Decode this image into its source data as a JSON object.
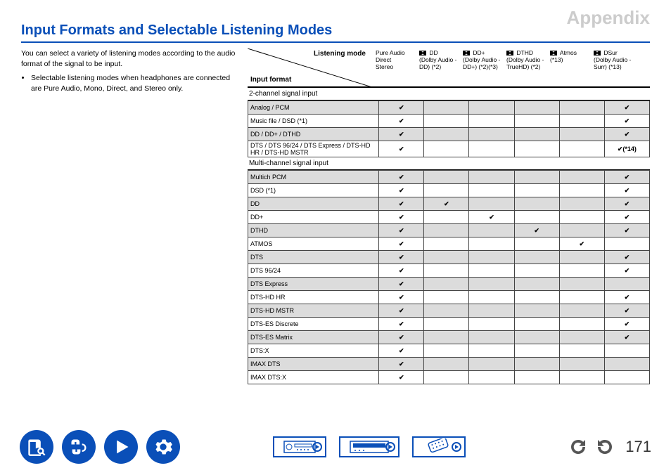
{
  "appendix": "Appendix",
  "title": "Input Formats and Selectable Listening Modes",
  "intro": "You can select a variety of listening modes according to the audio format of the signal to be input.",
  "bullet": "Selectable listening modes when headphones are connected are Pure Audio, Mono, Direct, and Stereo only.",
  "labels": {
    "listening_mode": "Listening mode",
    "input_format": "Input format"
  },
  "cols": [
    "Pure Audio\nDirect\nStereo",
    "DD (Dolby Audio - DD) (*2)",
    "DD+ (Dolby Audio - DD+) (*2)(*3)",
    "DTHD (Dolby Audio - TrueHD) (*2)",
    "Atmos (*13)",
    "DSur (Dolby Audio - Surr) (*13)"
  ],
  "col_has_dolby": [
    false,
    true,
    true,
    true,
    true,
    true
  ],
  "sections": [
    {
      "title": "2-channel signal input",
      "rows": [
        {
          "name": "Analog / PCM",
          "c": [
            "✔",
            "",
            "",
            "",
            "",
            "✔"
          ]
        },
        {
          "name": "Music file / DSD (*1)",
          "c": [
            "✔",
            "",
            "",
            "",
            "",
            "✔"
          ]
        },
        {
          "name": "DD / DD+ / DTHD",
          "c": [
            "✔",
            "",
            "",
            "",
            "",
            "✔"
          ]
        },
        {
          "name": "DTS / DTS 96/24 / DTS Express / DTS-HD HR / DTS-HD MSTR",
          "c": [
            "✔",
            "",
            "",
            "",
            "",
            "✔(*14)"
          ]
        }
      ]
    },
    {
      "title": "Multi-channel signal input",
      "rows": [
        {
          "name": "Multich PCM",
          "c": [
            "✔",
            "",
            "",
            "",
            "",
            "✔"
          ]
        },
        {
          "name": "DSD (*1)",
          "c": [
            "✔",
            "",
            "",
            "",
            "",
            "✔"
          ]
        },
        {
          "name": "DD",
          "c": [
            "✔",
            "✔",
            "",
            "",
            "",
            "✔"
          ]
        },
        {
          "name": "DD+",
          "c": [
            "✔",
            "",
            "✔",
            "",
            "",
            "✔"
          ]
        },
        {
          "name": "DTHD",
          "c": [
            "✔",
            "",
            "",
            "✔",
            "",
            "✔"
          ]
        },
        {
          "name": "ATMOS",
          "c": [
            "✔",
            "",
            "",
            "",
            "✔",
            ""
          ]
        },
        {
          "name": "DTS",
          "c": [
            "✔",
            "",
            "",
            "",
            "",
            "✔"
          ]
        },
        {
          "name": "DTS 96/24",
          "c": [
            "✔",
            "",
            "",
            "",
            "",
            "✔"
          ]
        },
        {
          "name": "DTS Express",
          "c": [
            "✔",
            "",
            "",
            "",
            "",
            ""
          ]
        },
        {
          "name": "DTS-HD HR",
          "c": [
            "✔",
            "",
            "",
            "",
            "",
            "✔"
          ]
        },
        {
          "name": "DTS-HD MSTR",
          "c": [
            "✔",
            "",
            "",
            "",
            "",
            "✔"
          ]
        },
        {
          "name": "DTS-ES Discrete",
          "c": [
            "✔",
            "",
            "",
            "",
            "",
            "✔"
          ]
        },
        {
          "name": "DTS-ES Matrix",
          "c": [
            "✔",
            "",
            "",
            "",
            "",
            "✔"
          ]
        },
        {
          "name": "DTS:X",
          "c": [
            "✔",
            "",
            "",
            "",
            "",
            ""
          ]
        },
        {
          "name": "IMAX DTS",
          "c": [
            "✔",
            "",
            "",
            "",
            "",
            ""
          ]
        },
        {
          "name": "IMAX DTS:X",
          "c": [
            "✔",
            "",
            "",
            "",
            "",
            ""
          ]
        }
      ]
    }
  ],
  "page_number": "171",
  "footer_icons": [
    "book-search-icon",
    "cables-icon",
    "play-icon",
    "gear-icon"
  ],
  "footer_boxes": [
    "receiver-front-icon",
    "receiver-display-icon",
    "remote-icon"
  ],
  "nav": [
    "back-icon",
    "forward-icon"
  ]
}
